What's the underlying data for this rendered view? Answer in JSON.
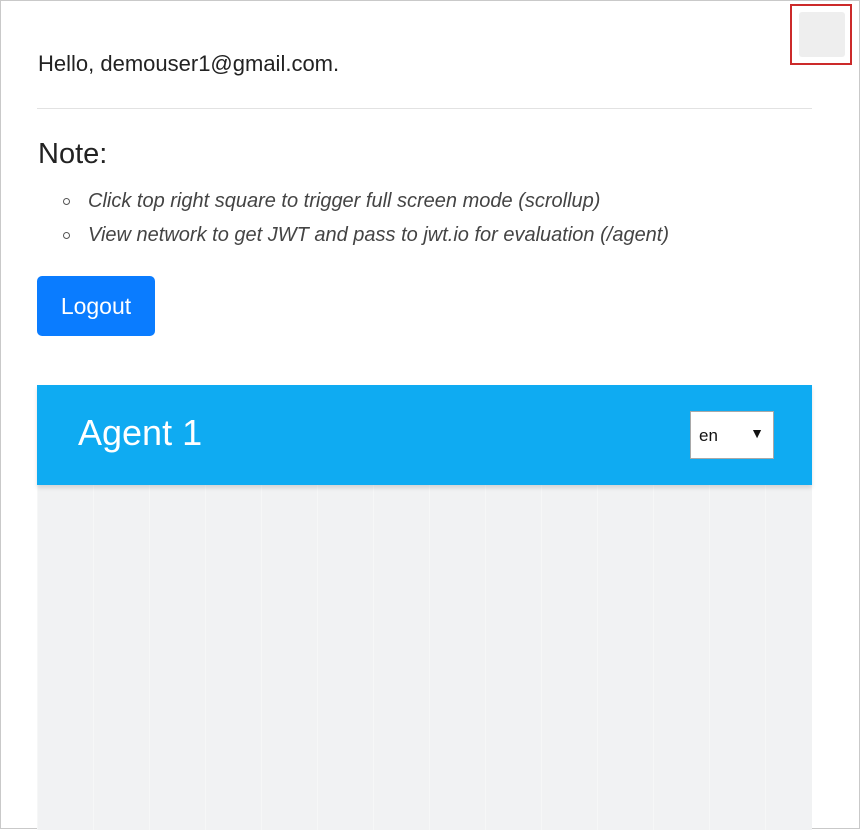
{
  "greeting": "Hello, demouser1@gmail.com.",
  "note": {
    "heading": "Note:",
    "items": [
      "Click top right square to trigger full screen mode (scrollup)",
      "View network to get JWT and pass to jwt.io for evaluation (/agent)"
    ]
  },
  "logout_label": "Logout",
  "agent": {
    "title": "Agent 1",
    "language_selected": "en",
    "caret_icon": "▼"
  },
  "colors": {
    "logout_button": "#0a7cff",
    "agent_header": "#0fabf2",
    "highlight_outline": "#cc2a2a",
    "chat_background": "#f1f2f3"
  }
}
